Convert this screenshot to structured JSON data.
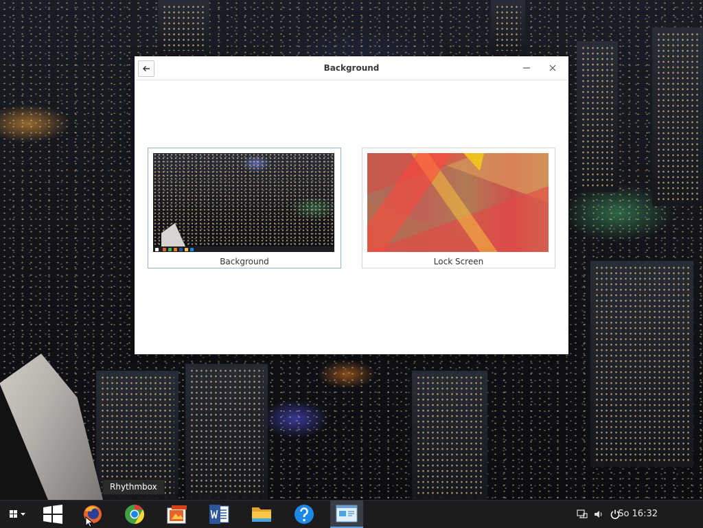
{
  "window": {
    "title": "Background",
    "cards": [
      {
        "label": "Background",
        "selected": true
      },
      {
        "label": "Lock Screen",
        "selected": false
      }
    ]
  },
  "desktop": {
    "tooltip": "Rhythmbox"
  },
  "taskbar": {
    "clock": "So 16:32",
    "apps": [
      {
        "name": "windows-logo-icon"
      },
      {
        "name": "firefox-icon"
      },
      {
        "name": "chrome-icon"
      },
      {
        "name": "image-viewer-icon"
      },
      {
        "name": "word-icon"
      },
      {
        "name": "file-explorer-icon"
      },
      {
        "name": "help-icon"
      },
      {
        "name": "background-settings-icon"
      }
    ],
    "colors": {
      "accent": "#5aa0e6",
      "bar": "#1c1c1f"
    }
  }
}
